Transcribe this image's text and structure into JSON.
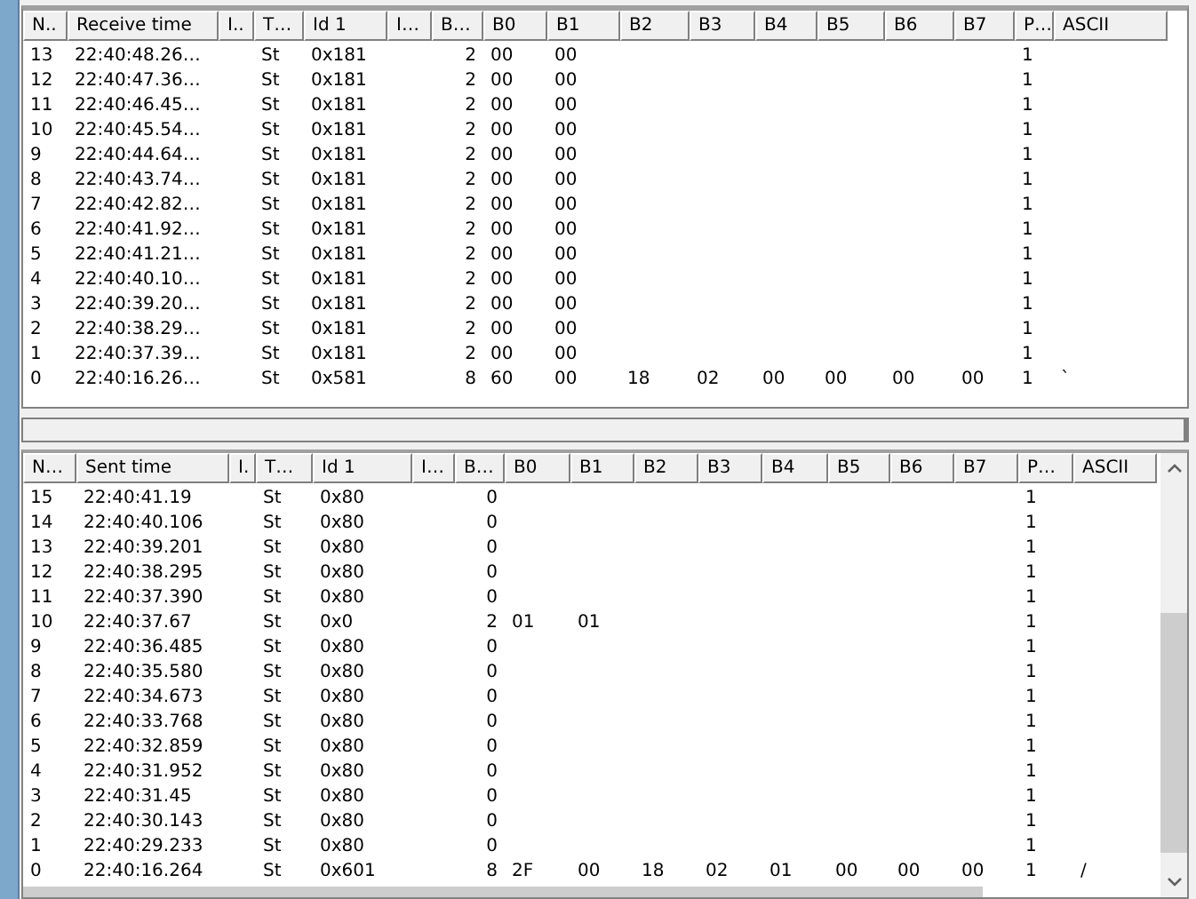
{
  "received": {
    "columns": [
      "N..",
      "Receive time",
      "I..",
      "T…",
      "Id 1",
      "I…",
      "B…",
      "B0",
      "B1",
      "B2",
      "B3",
      "B4",
      "B5",
      "B6",
      "B7",
      "P…",
      "ASCII"
    ],
    "rows": [
      {
        "n": "13",
        "time": "22:40:48.26…",
        "type": "St",
        "id": "0x181",
        "length": "2",
        "bytes": [
          "00",
          "00"
        ],
        "p": "1"
      },
      {
        "n": "12",
        "time": "22:40:47.36…",
        "type": "St",
        "id": "0x181",
        "length": "2",
        "bytes": [
          "00",
          "00"
        ],
        "p": "1"
      },
      {
        "n": "11",
        "time": "22:40:46.45…",
        "type": "St",
        "id": "0x181",
        "length": "2",
        "bytes": [
          "00",
          "00"
        ],
        "p": "1"
      },
      {
        "n": "10",
        "time": "22:40:45.54…",
        "type": "St",
        "id": "0x181",
        "length": "2",
        "bytes": [
          "00",
          "00"
        ],
        "p": "1"
      },
      {
        "n": "9",
        "time": "22:40:44.64…",
        "type": "St",
        "id": "0x181",
        "length": "2",
        "bytes": [
          "00",
          "00"
        ],
        "p": "1"
      },
      {
        "n": "8",
        "time": "22:40:43.74…",
        "type": "St",
        "id": "0x181",
        "length": "2",
        "bytes": [
          "00",
          "00"
        ],
        "p": "1"
      },
      {
        "n": "7",
        "time": "22:40:42.82…",
        "type": "St",
        "id": "0x181",
        "length": "2",
        "bytes": [
          "00",
          "00"
        ],
        "p": "1"
      },
      {
        "n": "6",
        "time": "22:40:41.92…",
        "type": "St",
        "id": "0x181",
        "length": "2",
        "bytes": [
          "00",
          "00"
        ],
        "p": "1"
      },
      {
        "n": "5",
        "time": "22:40:41.21…",
        "type": "St",
        "id": "0x181",
        "length": "2",
        "bytes": [
          "00",
          "00"
        ],
        "p": "1"
      },
      {
        "n": "4",
        "time": "22:40:40.10…",
        "type": "St",
        "id": "0x181",
        "length": "2",
        "bytes": [
          "00",
          "00"
        ],
        "p": "1"
      },
      {
        "n": "3",
        "time": "22:40:39.20…",
        "type": "St",
        "id": "0x181",
        "length": "2",
        "bytes": [
          "00",
          "00"
        ],
        "p": "1"
      },
      {
        "n": "2",
        "time": "22:40:38.29…",
        "type": "St",
        "id": "0x181",
        "length": "2",
        "bytes": [
          "00",
          "00"
        ],
        "p": "1"
      },
      {
        "n": "1",
        "time": "22:40:37.39…",
        "type": "St",
        "id": "0x181",
        "length": "2",
        "bytes": [
          "00",
          "00"
        ],
        "p": "1"
      },
      {
        "n": "0",
        "time": "22:40:16.26…",
        "type": "St",
        "id": "0x581",
        "length": "8",
        "bytes": [
          "60",
          "00",
          "18",
          "02",
          "00",
          "00",
          "00",
          "00"
        ],
        "p": "1",
        "ascii": "`"
      }
    ]
  },
  "sent": {
    "columns": [
      "N…",
      "Sent time",
      "I.",
      "T…",
      "Id 1",
      "I…",
      "B…",
      "B0",
      "B1",
      "B2",
      "B3",
      "B4",
      "B5",
      "B6",
      "B7",
      "P…",
      "ASCII"
    ],
    "rows": [
      {
        "n": "15",
        "time": "22:40:41.19",
        "type": "St",
        "id": "0x80",
        "length": "0",
        "p": "1"
      },
      {
        "n": "14",
        "time": "22:40:40.106",
        "type": "St",
        "id": "0x80",
        "length": "0",
        "p": "1"
      },
      {
        "n": "13",
        "time": "22:40:39.201",
        "type": "St",
        "id": "0x80",
        "length": "0",
        "p": "1"
      },
      {
        "n": "12",
        "time": "22:40:38.295",
        "type": "St",
        "id": "0x80",
        "length": "0",
        "p": "1"
      },
      {
        "n": "11",
        "time": "22:40:37.390",
        "type": "St",
        "id": "0x80",
        "length": "0",
        "p": "1"
      },
      {
        "n": "10",
        "time": "22:40:37.67",
        "type": "St",
        "id": "0x0",
        "length": "2",
        "bytes": [
          "01",
          "01"
        ],
        "p": "1"
      },
      {
        "n": "9",
        "time": "22:40:36.485",
        "type": "St",
        "id": "0x80",
        "length": "0",
        "p": "1"
      },
      {
        "n": "8",
        "time": "22:40:35.580",
        "type": "St",
        "id": "0x80",
        "length": "0",
        "p": "1"
      },
      {
        "n": "7",
        "time": "22:40:34.673",
        "type": "St",
        "id": "0x80",
        "length": "0",
        "p": "1"
      },
      {
        "n": "6",
        "time": "22:40:33.768",
        "type": "St",
        "id": "0x80",
        "length": "0",
        "p": "1"
      },
      {
        "n": "5",
        "time": "22:40:32.859",
        "type": "St",
        "id": "0x80",
        "length": "0",
        "p": "1"
      },
      {
        "n": "4",
        "time": "22:40:31.952",
        "type": "St",
        "id": "0x80",
        "length": "0",
        "p": "1"
      },
      {
        "n": "3",
        "time": "22:40:31.45",
        "type": "St",
        "id": "0x80",
        "length": "0",
        "p": "1"
      },
      {
        "n": "2",
        "time": "22:40:30.143",
        "type": "St",
        "id": "0x80",
        "length": "0",
        "p": "1"
      },
      {
        "n": "1",
        "time": "22:40:29.233",
        "type": "St",
        "id": "0x80",
        "length": "0",
        "p": "1"
      },
      {
        "n": "0",
        "time": "22:40:16.264",
        "type": "St",
        "id": "0x601",
        "length": "8",
        "bytes": [
          "2F",
          "00",
          "18",
          "02",
          "01",
          "00",
          "00",
          "00"
        ],
        "p": "1",
        "ascii": "/"
      }
    ]
  }
}
